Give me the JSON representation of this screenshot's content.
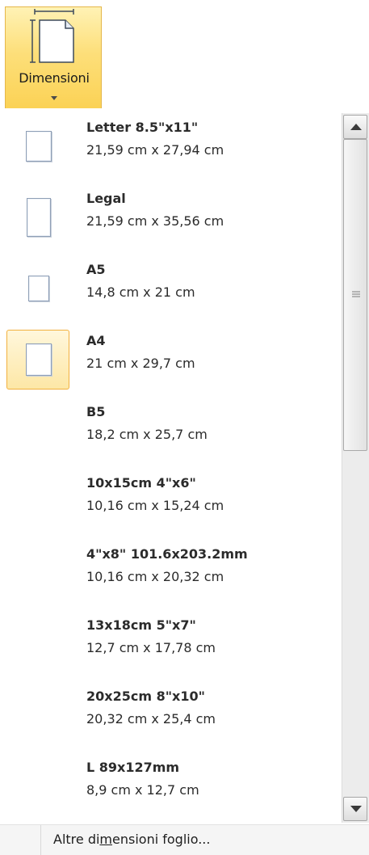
{
  "ribbon": {
    "button_label": "Dimensioni",
    "button_icon": "page-size-icon",
    "dropdown_icon": "chevron-down-icon",
    "accent_color": "#fbd255"
  },
  "sizes": [
    {
      "name": "Letter 8.5\"x11\"",
      "dims": "21,59 cm x 27,94 cm",
      "selected": false
    },
    {
      "name": "Legal",
      "dims": "21,59 cm x 35,56 cm",
      "selected": false
    },
    {
      "name": "A5",
      "dims": "14,8 cm x 21 cm",
      "selected": false
    },
    {
      "name": "A4",
      "dims": "21 cm x 29,7 cm",
      "selected": true
    },
    {
      "name": "B5",
      "dims": "18,2 cm x 25,7 cm",
      "selected": false
    },
    {
      "name": "10x15cm 4\"x6\"",
      "dims": "10,16 cm x 15,24 cm",
      "selected": false
    },
    {
      "name": "4\"x8\" 101.6x203.2mm",
      "dims": "10,16 cm x 20,32 cm",
      "selected": false
    },
    {
      "name": "13x18cm 5\"x7\"",
      "dims": "12,7 cm x 17,78 cm",
      "selected": false
    },
    {
      "name": "20x25cm 8\"x10\"",
      "dims": "20,32 cm x 25,4 cm",
      "selected": false
    },
    {
      "name": "L 89x127mm",
      "dims": "8,9 cm x 12,7 cm",
      "selected": false
    }
  ],
  "footer": {
    "more_sizes_before": "Altre di",
    "more_sizes_underlined": "m",
    "more_sizes_after": "ensioni foglio..."
  }
}
